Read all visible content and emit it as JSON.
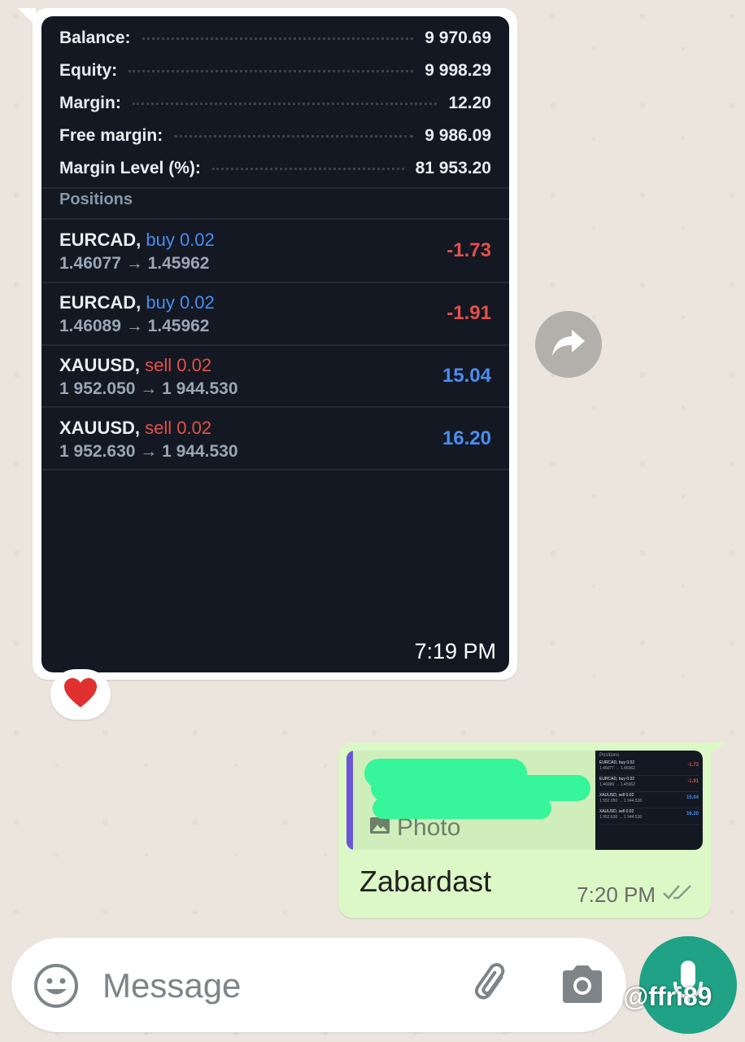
{
  "account": {
    "rows": [
      {
        "label": "Balance:",
        "value": "9 970.69"
      },
      {
        "label": "Equity:",
        "value": "9 998.29"
      },
      {
        "label": "Margin:",
        "value": "12.20"
      },
      {
        "label": "Free margin:",
        "value": "9 986.09"
      },
      {
        "label": "Margin Level (%):",
        "value": "81 953.20"
      }
    ]
  },
  "positions": {
    "title": "Positions",
    "items": [
      {
        "symbol": "EURCAD,",
        "side": "buy 0.02",
        "prices": "1.46077 → 1.45962",
        "pnl": "-1.73"
      },
      {
        "symbol": "EURCAD,",
        "side": "buy 0.02",
        "prices": "1.46089 → 1.45962",
        "pnl": "-1.91"
      },
      {
        "symbol": "XAUUSD,",
        "side": "sell 0.02",
        "prices": "1 952.050 → 1 944.530",
        "pnl": "15.04"
      },
      {
        "symbol": "XAUUSD,",
        "side": "sell 0.02",
        "prices": "1 952.630 → 1 944.530",
        "pnl": "16.20"
      }
    ]
  },
  "incoming": {
    "time": "7:19 PM",
    "reaction": "❤️"
  },
  "outgoing": {
    "quote_label": "Photo",
    "thumb": {
      "title": "Positions",
      "rows": [
        {
          "sym": "EURCAD, buy 0.02",
          "pr": "1.46077 → 1.45962",
          "pnl": "-1.73"
        },
        {
          "sym": "EURCAD, buy 0.02",
          "pr": "1.46089 → 1.45962",
          "pnl": "-1.91"
        },
        {
          "sym": "XAUUSD, sell 0.02",
          "pr": "1 952.050 → 1 944.530",
          "pnl": "15.04"
        },
        {
          "sym": "XAUUSD, sell 0.02",
          "pr": "1 952.630 → 1 944.530",
          "pnl": "16.20"
        }
      ]
    },
    "text": "Zabardast",
    "time": "7:20 PM"
  },
  "composer": {
    "placeholder": "Message"
  },
  "watermark": "@ffri89",
  "colors": {
    "accent": "#1fa286",
    "outgoing_bubble": "#dcf8c6",
    "chat_bg": "#ece5dd",
    "loss": "#e4504a",
    "profit": "#4b8df0"
  }
}
